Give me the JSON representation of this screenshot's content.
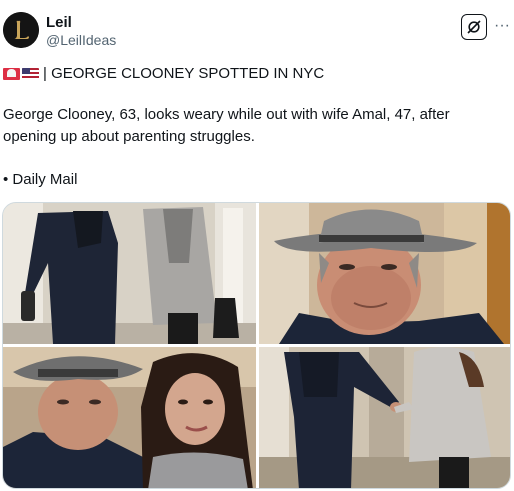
{
  "author": {
    "name": "Leil",
    "handle": "@LeilIdeas",
    "avatar_icon": "letter-l-logo-icon"
  },
  "actions": {
    "grok_icon": "grok-icon",
    "more_label": "···"
  },
  "tweet": {
    "headline": "| GEORGE CLOONEY SPOTTED IN NYC",
    "headline_emojis": [
      "siren-icon",
      "us-flag-icon"
    ],
    "body_line1": "George Clooney, 63, looks weary while out with wife Amal, 47, after",
    "body_line2": "opening up about parenting struggles.",
    "source": "• Daily Mail"
  },
  "media": {
    "photos": [
      {
        "name": "couple-walking-photo"
      },
      {
        "name": "clooney-hat-closeup-photo"
      },
      {
        "name": "clooney-and-amal-photo"
      },
      {
        "name": "couple-holding-hands-photo"
      }
    ]
  },
  "colors": {
    "text": "#0f1419",
    "secondary": "#536471",
    "border": "#cfd9de"
  }
}
